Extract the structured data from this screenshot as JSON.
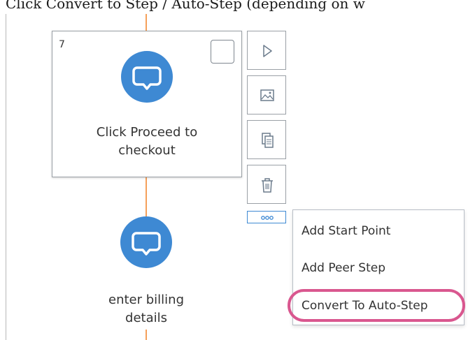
{
  "caption": "Click Convert to Step / Auto-Step (depending on w",
  "colors": {
    "connector": "#f5a05a",
    "bubble": "#3e89d3",
    "highlight": "#d9578f",
    "more_button_border": "#3e89d3"
  },
  "step_card": {
    "number": "7",
    "title_line1": "Click Proceed to",
    "title_line2": "checkout",
    "icon": "speech-bubble-icon",
    "checkbox_checked": false
  },
  "next_step": {
    "title_line1": "enter billing",
    "title_line2": "details",
    "icon": "speech-bubble-icon"
  },
  "toolbar": {
    "buttons": [
      {
        "icon": "play-icon"
      },
      {
        "icon": "image-icon"
      },
      {
        "icon": "copy-icon"
      },
      {
        "icon": "trash-icon"
      }
    ],
    "more_icon": "more-icon"
  },
  "menu": {
    "items": [
      {
        "label": "Add Start Point"
      },
      {
        "label": "Add Peer Step"
      },
      {
        "label": "Convert To Auto-Step",
        "highlighted": true
      }
    ]
  }
}
